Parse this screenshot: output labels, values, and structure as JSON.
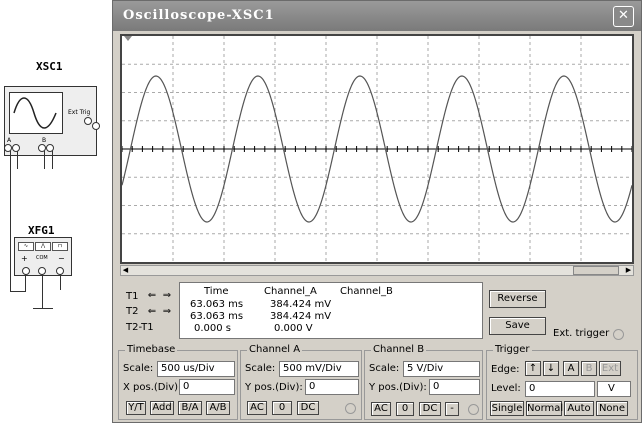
{
  "schematic": {
    "scope_label": "XSC1",
    "scope_ext_trig": "Ext Trig",
    "scope_pin_a": "A",
    "scope_pin_b": "B",
    "fg_label": "XFG1",
    "fg_plus": "+",
    "fg_com": "COM",
    "fg_minus": "−"
  },
  "window": {
    "title": "Oscilloscope-XSC1",
    "close_icon": "close-icon"
  },
  "measurements": {
    "headers": [
      "Time",
      "Channel_A",
      "Channel_B"
    ],
    "rows": [
      {
        "label": "T1",
        "time": "63.063 ms",
        "cha": "384.424 mV",
        "chb": ""
      },
      {
        "label": "T2",
        "time": "63.063 ms",
        "cha": "384.424 mV",
        "chb": ""
      },
      {
        "label": "T2-T1",
        "time": "0.000 s",
        "cha": "0.000 V",
        "chb": ""
      }
    ]
  },
  "buttons": {
    "reverse": "Reverse",
    "save": "Save",
    "ext_trigger": "Ext. trigger"
  },
  "timebase": {
    "title": "Timebase",
    "scale_label": "Scale:",
    "scale_value": "500 us/Div",
    "xpos_label": "X pos.(Div):",
    "xpos_value": "0",
    "modes": [
      "Y/T",
      "Add",
      "B/A",
      "A/B"
    ]
  },
  "channel_a": {
    "title": "Channel A",
    "scale_label": "Scale:",
    "scale_value": "500 mV/Div",
    "ypos_label": "Y pos.(Div):",
    "ypos_value": "0",
    "coupling": [
      "AC",
      "0",
      "DC"
    ]
  },
  "channel_b": {
    "title": "Channel B",
    "scale_label": "Scale:",
    "scale_value": "5  V/Div",
    "ypos_label": "Y pos.(Div):",
    "ypos_value": "0",
    "coupling": [
      "AC",
      "0",
      "DC",
      "-"
    ]
  },
  "trigger": {
    "title": "Trigger",
    "edge_label": "Edge:",
    "edge_buttons": [
      "A",
      "B",
      "Ext"
    ],
    "level_label": "Level:",
    "level_value": "0",
    "level_unit": "V",
    "modes": [
      "Single",
      "Normal",
      "Auto",
      "None"
    ]
  },
  "waveform": {
    "periods_visible": 5,
    "trace_color": "#555555"
  }
}
